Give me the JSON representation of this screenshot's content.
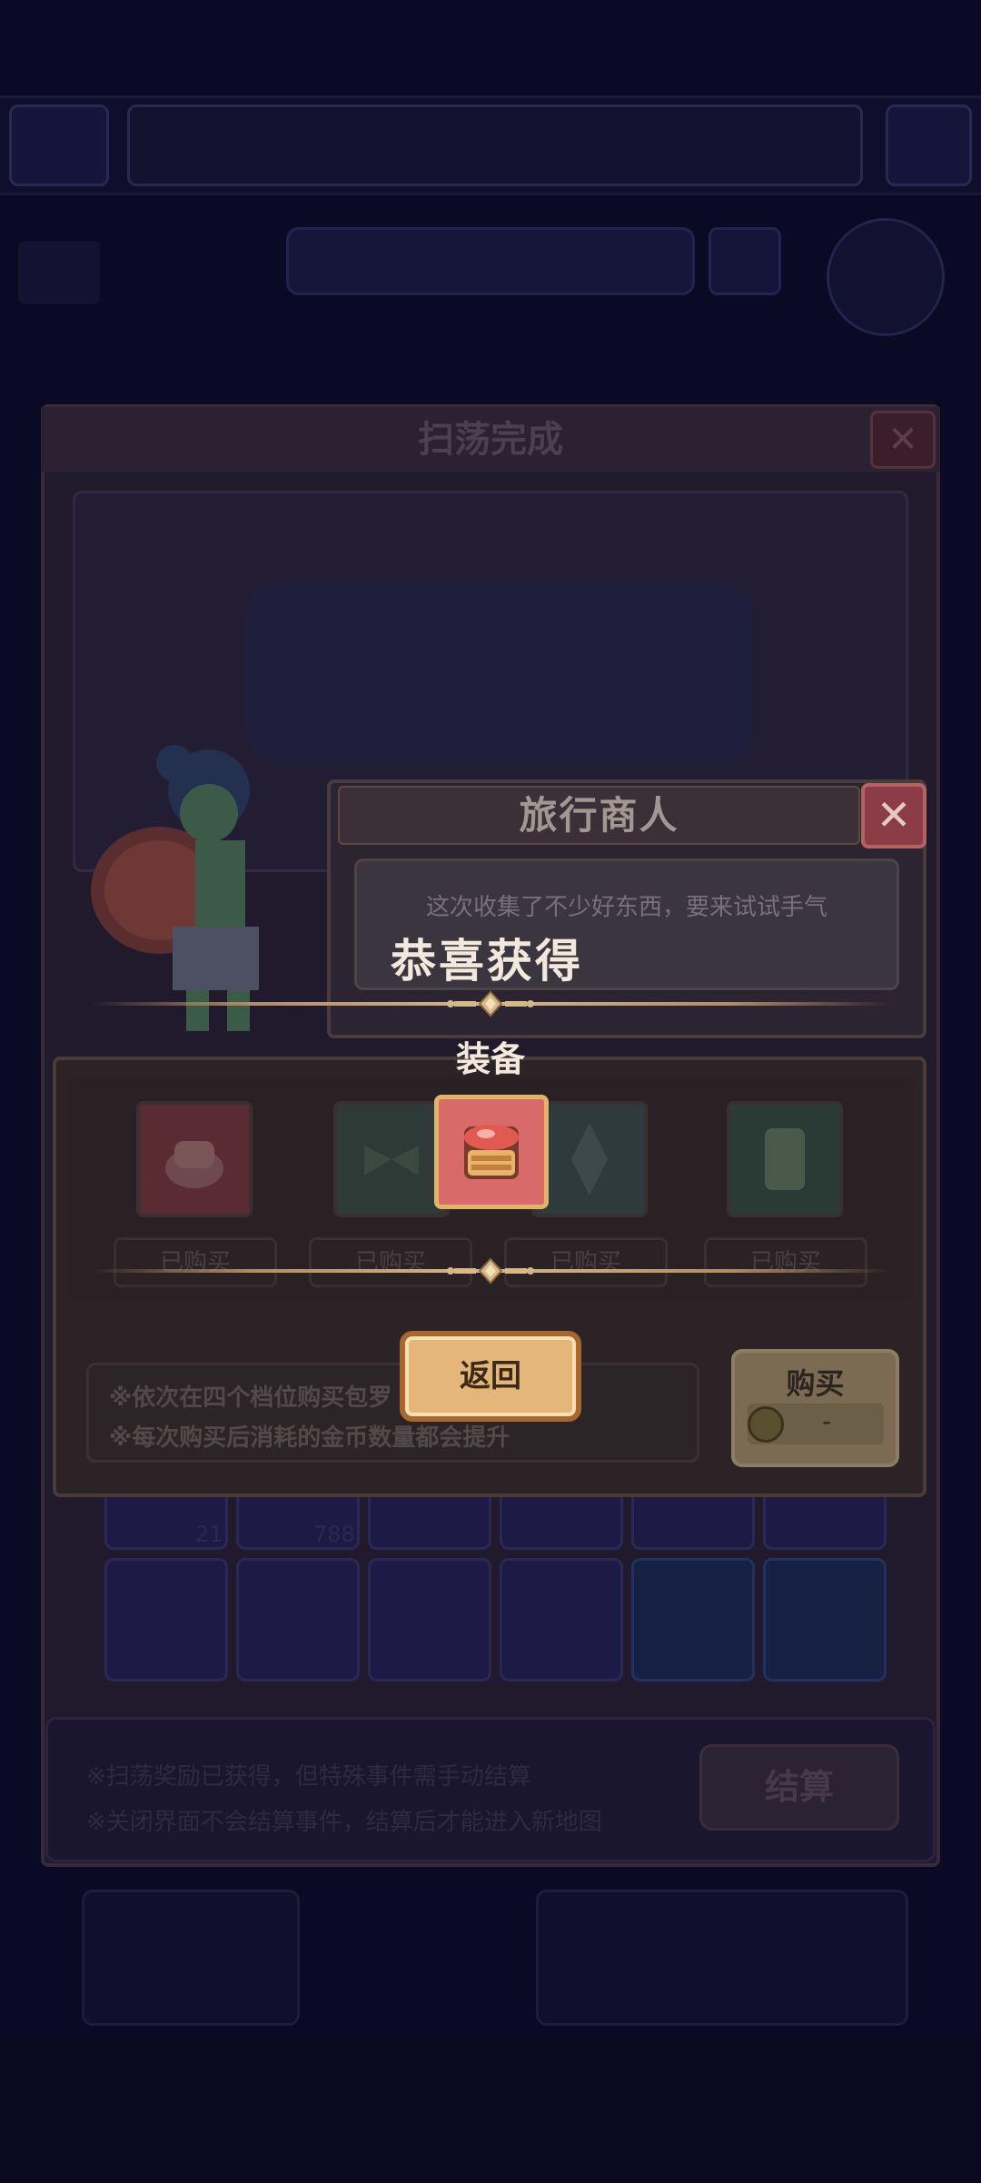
{
  "background": {
    "sweep_title": "扫荡完成",
    "settle_button": "结算",
    "notes": [
      "※扫荡奖励已获得，但特殊事件需手动结算",
      "※关闭界面不会结算事件，结算后才能进入新地图"
    ],
    "grid_counts": [
      "21",
      "788"
    ]
  },
  "merchant": {
    "title": "旅行商人",
    "close_icon": "close-icon",
    "message": "这次收集了不少好东西，要来试试手气"
  },
  "shop": {
    "items": [
      {
        "status": "已购买",
        "icon": "hat-icon",
        "color": "#5a2b33"
      },
      {
        "status": "已购买",
        "icon": "bow-icon",
        "color": "#2d3a35"
      },
      {
        "status": "已购买",
        "icon": "crystal-icon",
        "color": "#2e3a3b"
      },
      {
        "status": "已购买",
        "icon": "scroll-icon",
        "color": "#2a3a35"
      }
    ],
    "tips": [
      "※依次在四个档位购买包罗",
      "※每次购买后消耗的金币数量都会提升"
    ],
    "buy_label": "购买",
    "coin_value": "-"
  },
  "reward": {
    "title": "恭喜获得",
    "category": "装备",
    "item_icon": "helmet-icon",
    "return_label": "返回"
  }
}
